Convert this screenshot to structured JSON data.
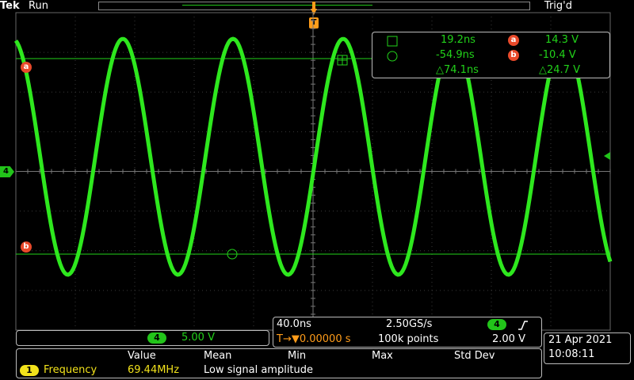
{
  "header": {
    "brand": "Tek",
    "run_state": "Run",
    "trigger_state": "Trig'd",
    "trigger_marker": "T"
  },
  "channel": {
    "number": "4",
    "scale": "5.00 V",
    "color": "#22c41a"
  },
  "cursors": {
    "a_label": "a",
    "b_label": "b",
    "time_a": "19.2ns",
    "time_b": "-54.9ns",
    "delta_time": "△74.1ns",
    "volt_a": "14.3 V",
    "volt_b": "-10.4 V",
    "delta_volt": "△24.7 V",
    "color": "#e8492a"
  },
  "horizontal": {
    "time_per_div": "40.0ns",
    "sample_rate": "2.50GS/s",
    "trigger_position": "T→▼0.00000 s",
    "record_length": "100k points",
    "trigger_channel": "4",
    "trigger_slope_icon": "rising-edge-icon",
    "trigger_level": "2.00 V"
  },
  "datetime": {
    "date": "21 Apr 2021",
    "time": "10:08:11"
  },
  "measurements": {
    "headers": [
      "Value",
      "Mean",
      "Min",
      "Max",
      "Std Dev"
    ],
    "row": {
      "index": "1",
      "name": "Frequency",
      "value": "69.44MHz",
      "note": "Low signal amplitude"
    }
  },
  "waveform": {
    "color": "#2ee81e"
  }
}
